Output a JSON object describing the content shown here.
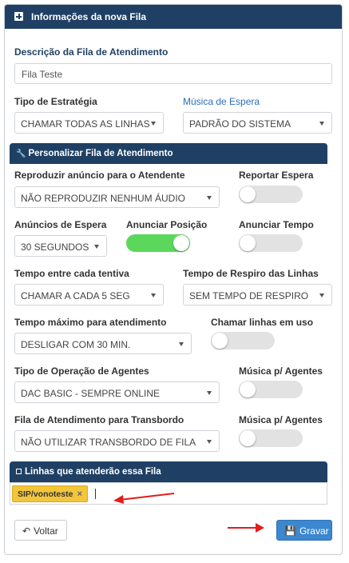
{
  "panel": {
    "title": "Informações da nova Fila"
  },
  "descricao": {
    "label": "Descrição da Fila de Atendimento",
    "value": "Fila Teste"
  },
  "estrategia": {
    "label": "Tipo de Estratégia",
    "value": "CHAMAR TODAS AS LINHAS"
  },
  "musica_espera": {
    "label": "Música de Espera",
    "value": "PADRÃO DO SISTEMA"
  },
  "personalizar": {
    "title": "Personalizar Fila de Atendimento",
    "reproduzir": {
      "label": "Reproduzir anúncio para o Atendente",
      "value": "NÃO REPRODUZIR NENHUM ÁUDIO"
    },
    "reportar_espera": {
      "label": "Reportar Espera",
      "on": false
    },
    "anuncios_espera": {
      "label": "Anúncios de Espera",
      "value": "30 SEGUNDOS"
    },
    "anunciar_posicao": {
      "label": "Anunciar Posição",
      "on": true
    },
    "anunciar_tempo": {
      "label": "Anunciar Tempo",
      "on": false
    },
    "tempo_tentiva": {
      "label": "Tempo entre cada tentiva",
      "value": "CHAMAR A CADA 5 SEG"
    },
    "tempo_respiro": {
      "label": "Tempo de Respiro das Linhas",
      "value": "SEM TEMPO DE RESPIRO"
    },
    "tempo_maximo": {
      "label": "Tempo máximo para atendimento",
      "value": "DESLIGAR COM 30 MIN."
    },
    "chamar_linhas": {
      "label": "Chamar linhas em uso",
      "on": false
    },
    "tipo_operacao": {
      "label": "Tipo de Operação de Agentes",
      "value": "DAC BASIC - SEMPRE ONLINE"
    },
    "musica_agentes_1": {
      "label": "Música p/ Agentes",
      "on": false
    },
    "transbordo": {
      "label": "Fila de Atendimento para Transbordo",
      "value": "NÃO UTILIZAR TRANSBORDO DE FILA"
    },
    "musica_agentes_2": {
      "label": "Música p/ Agentes",
      "on": false
    }
  },
  "linhas": {
    "title": "Linhas que atenderão essa Fila",
    "tags": [
      "SIP/vonoteste"
    ],
    "remove_glyph": "×"
  },
  "buttons": {
    "voltar": "Voltar",
    "gravar": "Gravar"
  },
  "icons": {
    "plus": "plus-square-icon",
    "wrench": "wrench-icon",
    "list": "list-icon",
    "back": "arrow-left-icon",
    "save": "floppy-disk-icon"
  },
  "colors": {
    "header": "#1f4064",
    "toggle_on": "#5bd85b",
    "tag": "#f3c53a",
    "primary": "#3c87cf",
    "annotation_arrow": "#e21d1d"
  }
}
